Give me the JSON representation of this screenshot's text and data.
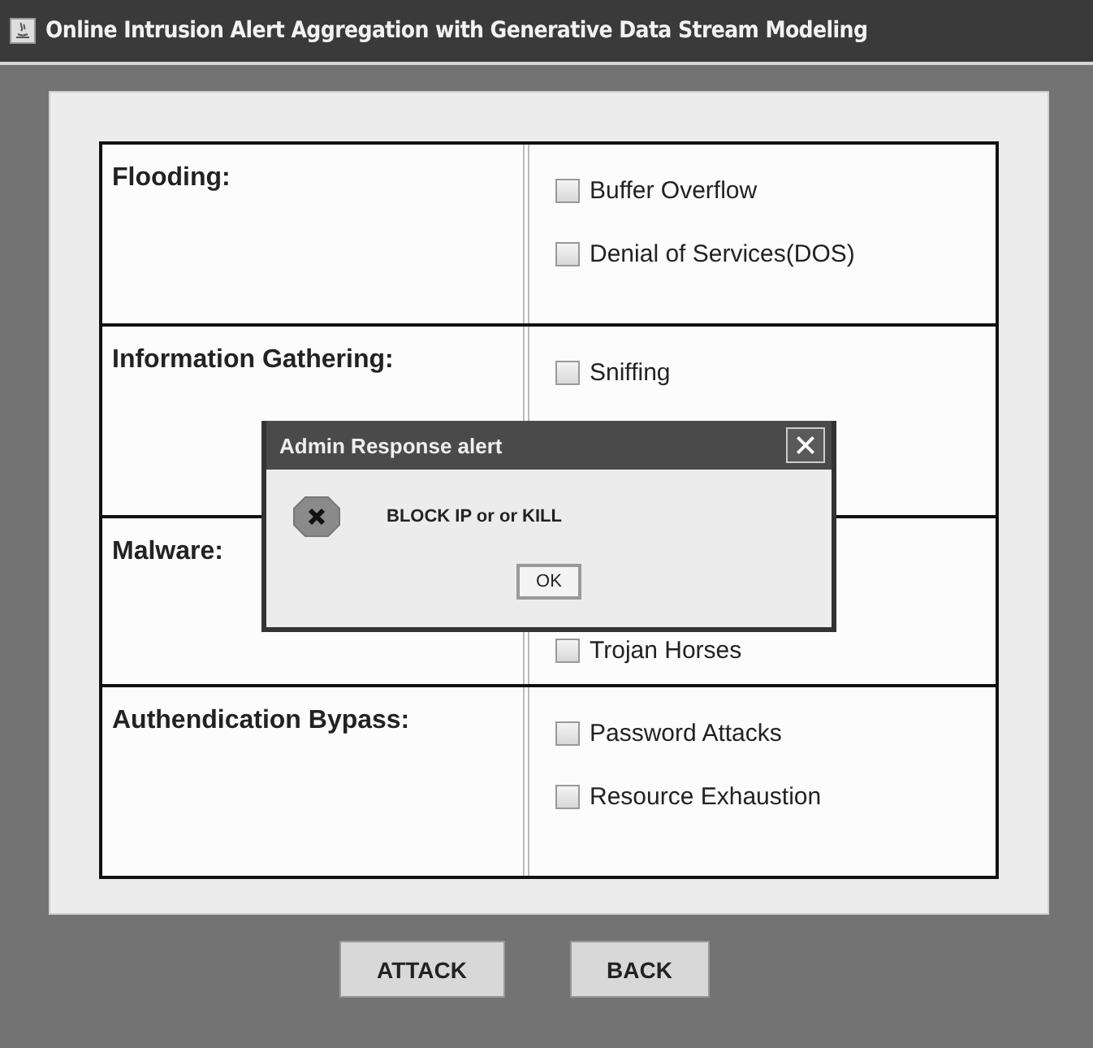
{
  "window": {
    "title": "Online Intrusion Alert Aggregation with Generative Data Stream Modeling"
  },
  "categories": [
    {
      "label": "Flooding:",
      "attacks": [
        {
          "label": "Buffer Overflow",
          "checked": false
        },
        {
          "label": "Denial of Services(DOS)",
          "checked": false
        }
      ]
    },
    {
      "label": "Information Gathering:",
      "attacks": [
        {
          "label": "Sniffing",
          "checked": false
        }
      ]
    },
    {
      "label": "Malware:",
      "attacks": [
        {
          "label": "Trojan Horses",
          "checked": false
        }
      ]
    },
    {
      "label": "Authendication Bypass:",
      "attacks": [
        {
          "label": "Password Attacks",
          "checked": false
        },
        {
          "label": "Resource Exhaustion",
          "checked": false
        }
      ]
    }
  ],
  "dialog": {
    "title": "Admin Response alert",
    "message": "BLOCK IP or or KILL",
    "button": "OK"
  },
  "buttons": [
    "ATTACK",
    "BACK"
  ]
}
